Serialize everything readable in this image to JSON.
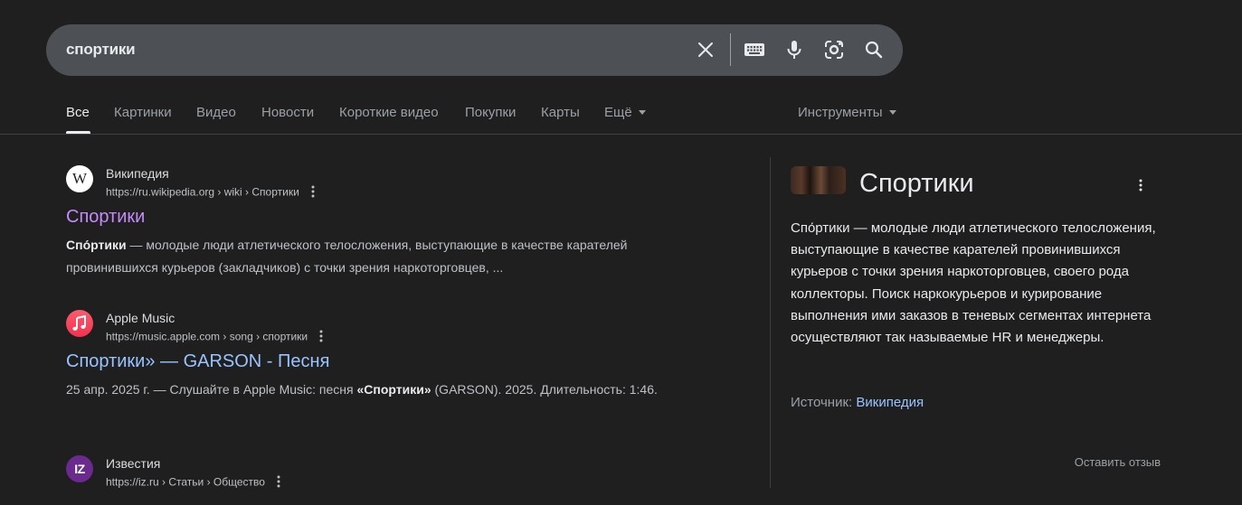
{
  "search": {
    "query": "спортики",
    "clear_icon": "close-icon",
    "keyboard_icon": "keyboard-icon",
    "voice_icon": "microphone-icon",
    "lens_icon": "camera-lens-icon",
    "search_icon": "search-icon"
  },
  "tabs": [
    {
      "label": "Все",
      "active": true
    },
    {
      "label": "Картинки"
    },
    {
      "label": "Видео"
    },
    {
      "label": "Новости"
    },
    {
      "label": "Короткие видео"
    },
    {
      "label": "Покупки"
    },
    {
      "label": "Карты"
    },
    {
      "label": "Ещё"
    }
  ],
  "tools_label": "Инструменты",
  "results": [
    {
      "site": "Википедия",
      "url": "https://ru.wikipedia.org › wiki › Спортики",
      "title": "Спортики",
      "snippet_bold": "Спо́ртики",
      "snippet_rest": " — молодые люди атлетического телосложения, выступающие в качестве карателей провинившихся курьеров (закладчиков) с точки зрения наркоторговцев, ...",
      "favicon_letter": "W",
      "favicon_icon": "wikipedia-icon"
    },
    {
      "site": "Apple Music",
      "url": "https://music.apple.com › song › спортики",
      "title": "Спортики» — GARSON - Песня",
      "snippet_pre": "25 апр. 2025 г. — Слушайте в Apple Music: песня ",
      "snippet_bold": "«Спортики»",
      "snippet_post": " (GARSON). 2025. Длительность: 1:46.",
      "favicon_icon": "apple-music-icon"
    },
    {
      "site": "Известия",
      "url": "https://iz.ru › Статьи › Общество",
      "favicon_letter": "IZ",
      "favicon_icon": "izvestia-icon"
    }
  ],
  "knowledge_panel": {
    "title": "Спортики",
    "description": "Спо́ртики — молодые люди атлетического телосложения, выступающие в качестве карателей провинившихся курьеров с точки зрения наркоторговцев, своего рода коллекторы. Поиск наркокурьеров и курирование выполнения ими заказов в теневых сегментах интернета осуществляют так называемые HR и менеджеры.",
    "source_label": "Источник:",
    "source_link": "Википедия",
    "feedback": "Оставить отзыв"
  },
  "colors": {
    "background": "#1f1f1f",
    "search_bar": "#4d5156",
    "link": "#99c3ff",
    "visited_link": "#c58af9",
    "muted": "#9aa0a6"
  }
}
